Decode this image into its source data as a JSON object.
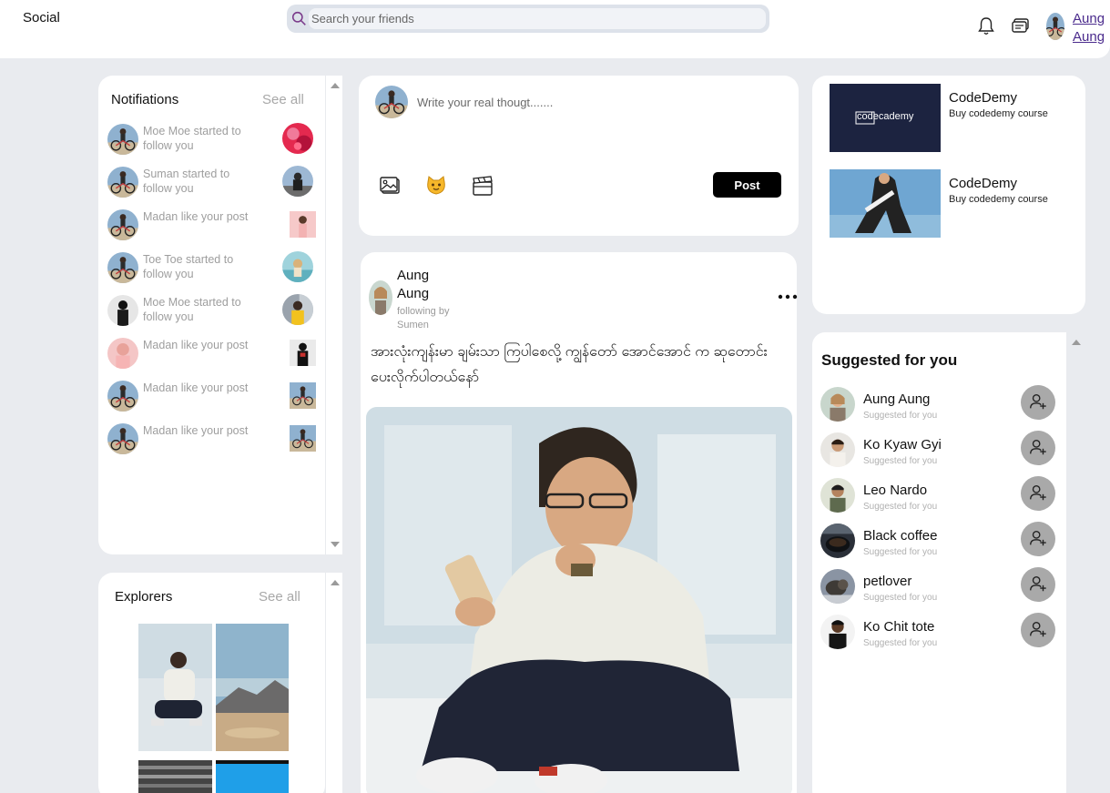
{
  "header": {
    "brand": "Social",
    "search_placeholder": "Search your friends",
    "user_name": "Aung Aung"
  },
  "notifications": {
    "title": "Notifiations",
    "see_all": "See all",
    "items": [
      {
        "text": "Moe Moe started to follow you"
      },
      {
        "text": "Suman started to follow you"
      },
      {
        "text": "Madan like your post"
      },
      {
        "text": "Toe Toe started to follow you"
      },
      {
        "text": "Moe Moe started to follow you"
      },
      {
        "text": "Madan like your post"
      },
      {
        "text": "Madan like your post"
      },
      {
        "text": "Madan like your post"
      }
    ]
  },
  "explorers": {
    "title": "Explorers",
    "see_all": "See all"
  },
  "composer": {
    "placeholder": "Write your real thougt.......",
    "post_label": "Post",
    "tools": [
      "image-icon",
      "emoji-icon",
      "video-icon"
    ]
  },
  "post": {
    "author": "Aung Aung",
    "subtitle": "following by Sumen",
    "text": "အားလုံးကျန်းမာ ချမ်းသာ ကြပါစေလို့ ကျွန်တော် အောင်အောင် က ဆုတောင်းပေးလိုက်ပါတယ်နော်"
  },
  "ads": [
    {
      "logo_text": "codecademy",
      "title": "CodeDemy",
      "subtitle": "Buy codedemy course"
    },
    {
      "title": "CodeDemy",
      "subtitle": "Buy codedemy course"
    }
  ],
  "suggested": {
    "title": "Suggested for you",
    "items": [
      {
        "name": "Aung Aung",
        "sub": "Suggested for you"
      },
      {
        "name": "Ko Kyaw Gyi",
        "sub": "Suggested for you"
      },
      {
        "name": "Leo Nardo",
        "sub": "Suggested for you"
      },
      {
        "name": "Black coffee",
        "sub": "Suggested for you"
      },
      {
        "name": "petlover",
        "sub": "Suggested for you"
      },
      {
        "name": "Ko Chit tote",
        "sub": "Suggested for you"
      }
    ]
  },
  "colors": {
    "background": "#e9ebef",
    "link": "#4a2a8c",
    "post_button": "#000000",
    "add_button": "#a9a9a9"
  }
}
